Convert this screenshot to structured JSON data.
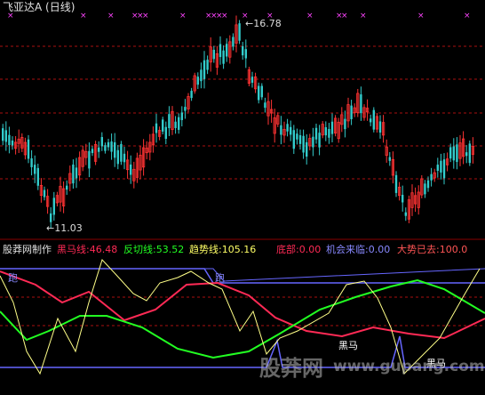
{
  "header": {
    "title": "飞亚达A (日线)"
  },
  "main_chart": {
    "high_label": "16.78",
    "low_label": "11.03"
  },
  "indicator": {
    "label": "股莽网制作",
    "heima": {
      "text": "黑马线:46.48",
      "color": "#ff2a55"
    },
    "fanqie": {
      "text": "反切线:53.52",
      "color": "#22ff22"
    },
    "qushi": {
      "text": "趋势线:105.16",
      "color": "#ffff66"
    },
    "dibu": {
      "text": "底部:0.00",
      "color": "#ff2a55"
    },
    "jihui": {
      "text": "机会来临:0.00",
      "color": "#8888ff"
    },
    "dashi": {
      "text": "大势已去:100.0",
      "color": "#ff5555"
    }
  },
  "annotations": {
    "pao_left": "跑",
    "pao_mid": "跑",
    "heima_mark": "黑马",
    "heima_mark2": "黑马"
  },
  "watermark": {
    "left": "股莽网",
    "right": "www.gupang.com"
  },
  "colors": {
    "up": "#ff3333",
    "down": "#33cccc",
    "marker": "#ff44ff",
    "dashed": "#aa1111"
  }
}
